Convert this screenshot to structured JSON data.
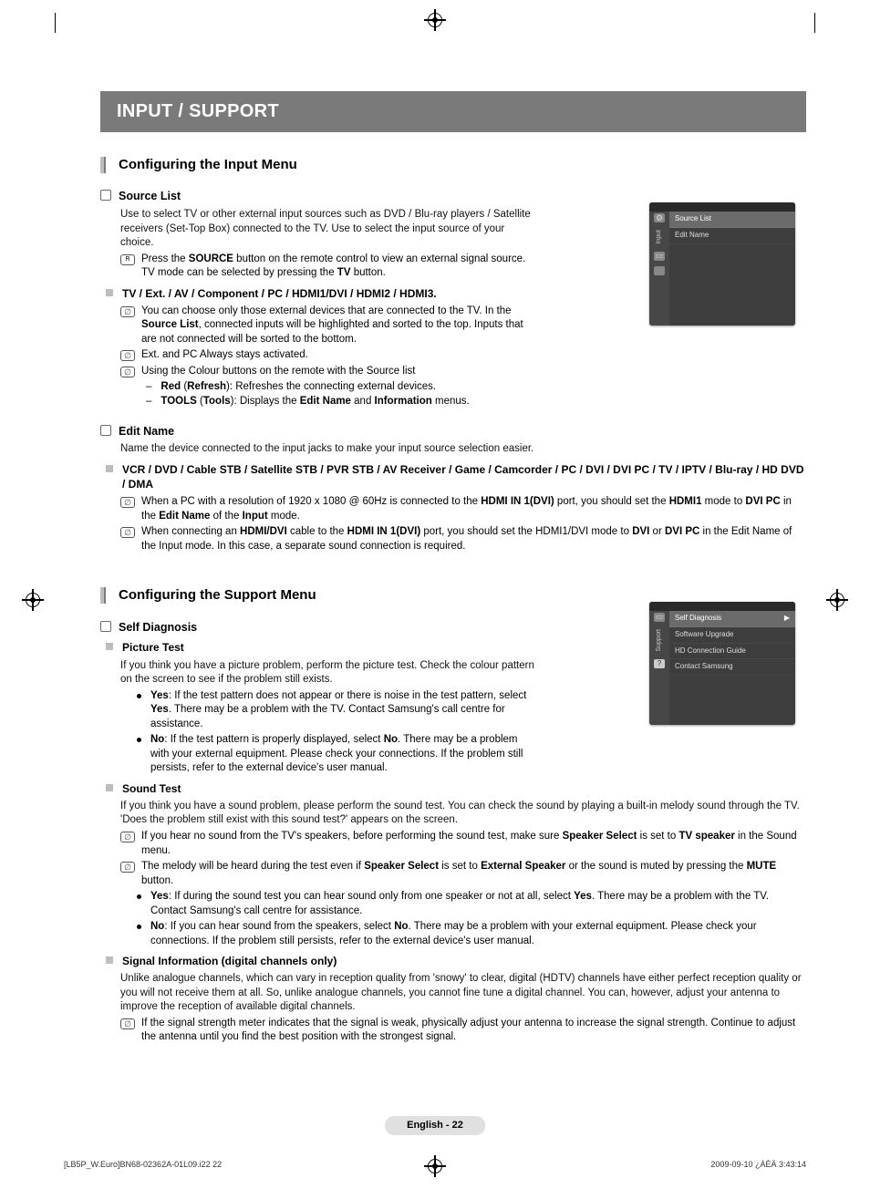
{
  "titleBar": "INPUT / SUPPORT",
  "sectionA": {
    "heading": "Configuring the Input Menu",
    "sourceList": {
      "title": "Source List",
      "desc": "Use to select TV or other external input sources such as DVD / Blu-ray players / Satellite receivers (Set-Top Box) connected to the TV. Use to select the input source of your choice.",
      "remoteNote_prefix": "Press the ",
      "remoteNote_b1": "SOURCE",
      "remoteNote_mid": " button on the remote control to view an external signal source. TV mode can be selected by pressing the ",
      "remoteNote_b2": "TV",
      "remoteNote_suffix": " button.",
      "inputsLine": "TV / Ext. / AV / Component / PC / HDMI1/DVI / HDMI2 / HDMI3.",
      "z1_a": "You can choose only those external devices that are connected to the TV. In the ",
      "z1_b": "Source List",
      "z1_c": ", connected inputs will be highlighted and sorted to the top. Inputs that are not connected will be sorted to the bottom.",
      "z2": "Ext. and PC Always stays activated.",
      "z3": "Using the Colour buttons on the remote with the Source list",
      "dash1_b": "Red",
      "dash1_p1": " (",
      "dash1_b2": "Refresh",
      "dash1_p2": "): Refreshes the connecting external devices.",
      "dash2_b": "TOOLS",
      "dash2_p1": " (",
      "dash2_b2": "Tools",
      "dash2_p2": "): Displays the ",
      "dash2_b3": "Edit Name",
      "dash2_and": " and ",
      "dash2_b4": "Information",
      "dash2_end": " menus."
    },
    "editName": {
      "title": "Edit Name",
      "desc": "Name the device connected to the input jacks to make your input source selection easier.",
      "devices": "VCR / DVD / Cable STB / Satellite STB / PVR STB / AV Receiver / Game / Camcorder / PC / DVI / DVI PC / TV / IPTV / Blu-ray / HD DVD / DMA",
      "z1_a": "When a PC with a resolution of 1920 x 1080 @ 60Hz is connected to the ",
      "z1_b1": "HDMI IN 1(DVI)",
      "z1_mid": " port, you should set the ",
      "z1_b2": "HDMI1",
      "z1_mid2": " mode to ",
      "z1_b3": "DVI PC",
      "z1_mid3": " in the ",
      "z1_b4": "Edit Name",
      "z1_mid4": " of the ",
      "z1_b5": "Input",
      "z1_end": " mode.",
      "z2_a": "When connecting an ",
      "z2_b1": "HDMI/DVI",
      "z2_mid1": " cable to the ",
      "z2_b2": "HDMI IN 1(DVI)",
      "z2_mid2": " port, you should set the HDMI1/DVI mode to ",
      "z2_b3": "DVI",
      "z2_or": " or ",
      "z2_b4": "DVI PC",
      "z2_end": " in the Edit Name of the Input mode. In this case, a separate sound connection is required."
    }
  },
  "sectionB": {
    "heading": "Configuring the Support Menu",
    "selfDiag": {
      "title": "Self Diagnosis",
      "pictureTest": {
        "title": "Picture Test",
        "desc": "If you think you have a picture problem, perform the picture test. Check the colour pattern on the screen to see if the problem still exists.",
        "yes_b": "Yes",
        "yes_txt": ": If the test pattern does not appear or there is noise in the test pattern, select ",
        "yes_b2": "Yes",
        "yes_end": ". There may be a problem with the TV. Contact Samsung's call centre for assistance.",
        "no_b": "No",
        "no_txt": ": If the test pattern is properly displayed, select ",
        "no_b2": "No",
        "no_end": ". There may be a problem with your external equipment. Please check your connections. If the problem still persists, refer to the external device's user manual."
      },
      "soundTest": {
        "title": "Sound Test",
        "desc": "If you think you have a sound problem, please perform the sound test. You can check the sound by playing a built-in melody sound through the TV. 'Does the problem still exist with this sound test?' appears on the screen.",
        "z1_a": "If you hear no sound from the TV's speakers, before performing the sound test, make sure ",
        "z1_b1": "Speaker Select",
        "z1_mid": " is set to ",
        "z1_b2": "TV speaker",
        "z1_end": " in the Sound menu.",
        "z2_a": "The melody will be heard during the test even if ",
        "z2_b1": "Speaker Select",
        "z2_mid": " is set to ",
        "z2_b2": "External Speaker",
        "z2_mid2": " or the sound is muted by pressing the ",
        "z2_b3": "MUTE",
        "z2_end": " button.",
        "yes_b": "Yes",
        "yes_txt": ": If during the sound test you can hear sound only from one speaker or not at all, select ",
        "yes_b2": "Yes",
        "yes_end": ". There may be a problem with the TV. Contact Samsung's call centre for assistance.",
        "no_b": "No",
        "no_txt": ": If you can hear sound from the speakers, select ",
        "no_b2": "No",
        "no_end": ". There may be a problem with your external equipment. Please check your connections. If the problem still persists, refer to the external device's user manual."
      },
      "signalInfo": {
        "title": "Signal Information (digital channels only)",
        "desc": "Unlike analogue channels, which can vary in reception quality from 'snowy' to clear, digital (HDTV) channels have either perfect reception quality or you will not receive them at all. So, unlike analogue channels, you cannot fine tune a digital channel. You can, however, adjust your antenna to improve the reception of available digital channels.",
        "z1": "If the signal strength meter indicates that the signal is weak, physically adjust your antenna to increase the signal strength. Continue to adjust the antenna until you find the best position with the strongest signal."
      }
    }
  },
  "osd1": {
    "sideLabel": "Input",
    "item1": "Source List",
    "item2": "Edit Name"
  },
  "osd2": {
    "sideLabel": "Support",
    "item1": "Self Diagnosis",
    "item2": "Software Upgrade",
    "item3": "HD Connection Guide",
    "item4": "Contact Samsung"
  },
  "footer": {
    "pageLabel": "English - 22",
    "left": "[LB5P_W.Euro]BN68-02362A-01L09.i22   22",
    "right": "2009-09-10   ¿ÀÈÄ 3:43:14"
  }
}
